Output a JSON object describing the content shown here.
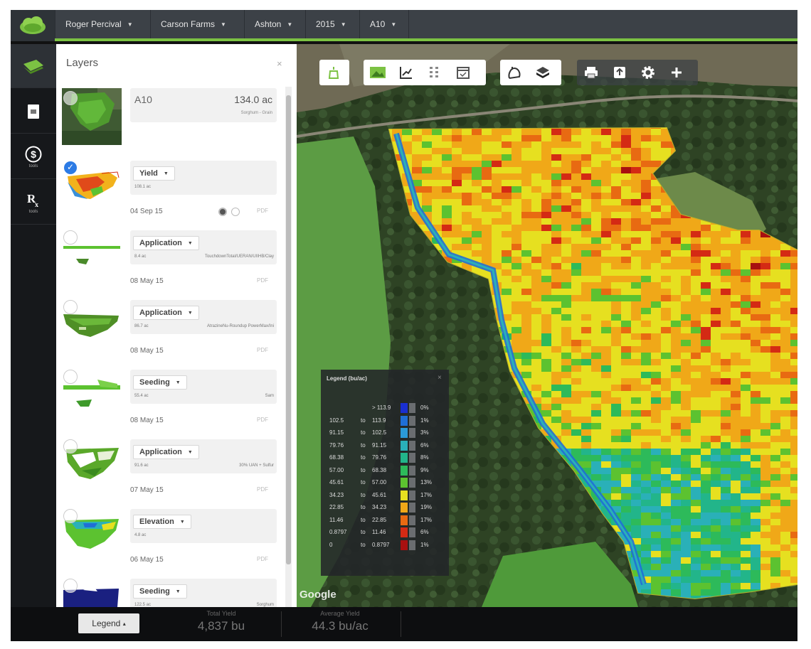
{
  "topbar": {
    "breadcrumbs": [
      "Roger Percival",
      "Carson Farms",
      "Ashton",
      "2015",
      "A10"
    ]
  },
  "rail": {
    "items": [
      {
        "icon": "field-layers-icon",
        "label": ""
      },
      {
        "icon": "document-icon",
        "label": ""
      },
      {
        "icon": "dollar-icon",
        "label": "tools"
      },
      {
        "icon": "prescription-icon",
        "label": "tools"
      }
    ]
  },
  "layers_panel": {
    "title": "Layers",
    "close": "×",
    "field": {
      "name": "A10",
      "area": "134.0 ac",
      "crop": "Sorghum - Grain"
    },
    "items": [
      {
        "type": "Yield",
        "acres": "108.1 ac",
        "product": "",
        "date": "04 Sep 15",
        "pdf": "PDF",
        "checked": true
      },
      {
        "type": "Application",
        "acres": "8.4 ac",
        "product": "TouchdownTotal/UERAN/UIIHB/Clay",
        "date": "08 May 15",
        "pdf": "PDF",
        "checked": false
      },
      {
        "type": "Application",
        "acres": "86.7 ac",
        "product": "AtrazineNu-Roundup PowerMax/Ini",
        "date": "08 May 15",
        "pdf": "PDF",
        "checked": false
      },
      {
        "type": "Seeding",
        "acres": "55.4 ac",
        "product": "Sam",
        "date": "08 May 15",
        "pdf": "PDF",
        "checked": false
      },
      {
        "type": "Application",
        "acres": "91.6 ac",
        "product": "30% UAN + Sulfur",
        "date": "07 May 15",
        "pdf": "PDF",
        "checked": false
      },
      {
        "type": "Elevation",
        "acres": "4.8 ac",
        "product": "",
        "date": "06 May 15",
        "pdf": "PDF",
        "checked": false
      },
      {
        "type": "Seeding",
        "acres": "122.5 ac",
        "product": "Sorghum",
        "date": "",
        "pdf": "",
        "checked": false
      }
    ]
  },
  "map_legend": {
    "title": "Legend (bu/ac)",
    "close": "×",
    "rows": [
      {
        "lo": "",
        "to": "",
        "hi": "> 113.9",
        "color": "#1a2fd0",
        "pct": "0%"
      },
      {
        "lo": "102.5",
        "to": "to",
        "hi": "113.9",
        "color": "#1f6fd6",
        "pct": "1%"
      },
      {
        "lo": "91.15",
        "to": "to",
        "hi": "102.5",
        "color": "#2b9ad8",
        "pct": "3%"
      },
      {
        "lo": "79.76",
        "to": "to",
        "hi": "91.15",
        "color": "#2ab0b8",
        "pct": "6%"
      },
      {
        "lo": "68.38",
        "to": "to",
        "hi": "79.76",
        "color": "#22b58a",
        "pct": "8%"
      },
      {
        "lo": "57.00",
        "to": "to",
        "hi": "68.38",
        "color": "#2dba5a",
        "pct": "9%"
      },
      {
        "lo": "45.61",
        "to": "to",
        "hi": "57.00",
        "color": "#5cc230",
        "pct": "13%"
      },
      {
        "lo": "34.23",
        "to": "to",
        "hi": "45.61",
        "color": "#e6e020",
        "pct": "17%"
      },
      {
        "lo": "22.85",
        "to": "to",
        "hi": "34.23",
        "color": "#f0a818",
        "pct": "19%"
      },
      {
        "lo": "11.46",
        "to": "to",
        "hi": "22.85",
        "color": "#e86a12",
        "pct": "17%"
      },
      {
        "lo": "0.8797",
        "to": "to",
        "hi": "11.46",
        "color": "#d42a14",
        "pct": "6%"
      },
      {
        "lo": "0",
        "to": "to",
        "hi": "0.8797",
        "color": "#a81010",
        "pct": "1%"
      }
    ]
  },
  "map": {
    "attribution": "Google"
  },
  "bottombar": {
    "legend_button": "Legend",
    "legend_caret": "▴",
    "total_yield_label": "Total Yield",
    "total_yield_value": "4,837 bu",
    "avg_yield_label": "Average Yield",
    "avg_yield_value": "44.3 bu/ac"
  },
  "colors": {
    "accent": "#7cc243",
    "topbar": "#3c4147",
    "check": "#2c7be5"
  }
}
